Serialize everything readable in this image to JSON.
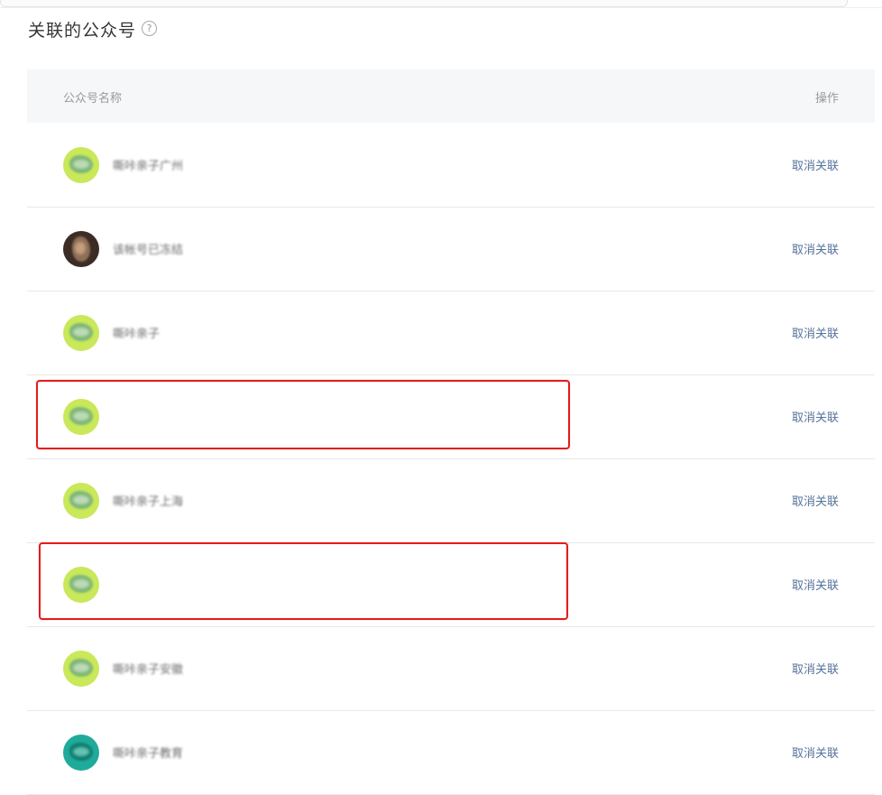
{
  "section": {
    "title": "关联的公众号",
    "help_icon_text": "?"
  },
  "table": {
    "headers": {
      "name": "公众号名称",
      "action": "操作"
    },
    "rows": [
      {
        "avatar": "green-logo-avatar",
        "name": "嘶咔亲子广州",
        "action": "取消关联"
      },
      {
        "avatar": "photo-avatar",
        "name": "该帐号已冻结",
        "action": "取消关联"
      },
      {
        "avatar": "green-logo-avatar",
        "name": "嘶咔亲子",
        "action": "取消关联"
      },
      {
        "avatar": "green-logo-avatar",
        "name": "",
        "action": "取消关联"
      },
      {
        "avatar": "green-logo-avatar",
        "name": "嘶咔亲子上海",
        "action": "取消关联"
      },
      {
        "avatar": "green-logo-avatar",
        "name": "",
        "action": "取消关联"
      },
      {
        "avatar": "green-logo-avatar",
        "name": "嘶咔亲子安徽",
        "action": "取消关联"
      },
      {
        "avatar": "teal-logo-avatar",
        "name": "嘶咔亲子教育",
        "action": "取消关联"
      }
    ]
  },
  "colors": {
    "link": "#56739a",
    "highlight": "#e51b1b",
    "header_bg": "#f6f7f9"
  }
}
